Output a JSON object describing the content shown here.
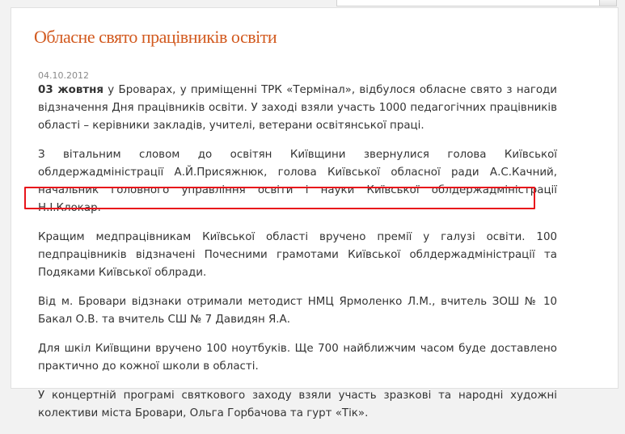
{
  "article": {
    "title": "Обласне свято працівників освіти",
    "date": "04.10.2012",
    "lead_bold": "03  жовтня",
    "lead_rest": " у Броварах, у приміщенні ТРК «Термінал», відбулося обласне свято з нагоди відзначення Дня працівників освіти.  У заході взяли участь 1000 педагогічних працівників області – керівники закладів, учителі, ветерани освітянської праці.",
    "paragraphs": [
      "З вітальним словом до освітян  Київщини звернулися голова Київської облдержадміністрації А.Й.Присяжнюк, голова Київської обласної ради А.С.Качний,  начальник головного управління освіти і науки Київської облдержадміністрації Н.І.Клокар.",
      "Кращим медпрацівникам    Київської області вручено премії у галузі освіти.  100 педпрацівників відзначені Почесними грамотами Київської облдержадміністрації та Подяками Київської облради.",
      "Від м. Бровари відзнаки отримали методист НМЦ Ярмоленко Л.М., вчитель ЗОШ № 10 Бакал О.В. та вчитель СШ № 7 Давидян Я.А.",
      "Для шкіл Київщини вручено 100 ноутбуків. Ще 700 найближчим часом буде доставлено практично до кожної школи в області.",
      "У концертній програмі святкового заходу взяли участь зразкові та народні художні колективи міста Бровари, Ольга Горбачова та гурт «Тік»."
    ]
  },
  "highlight_color": "#e8141b",
  "title_color": "#d25a1f"
}
